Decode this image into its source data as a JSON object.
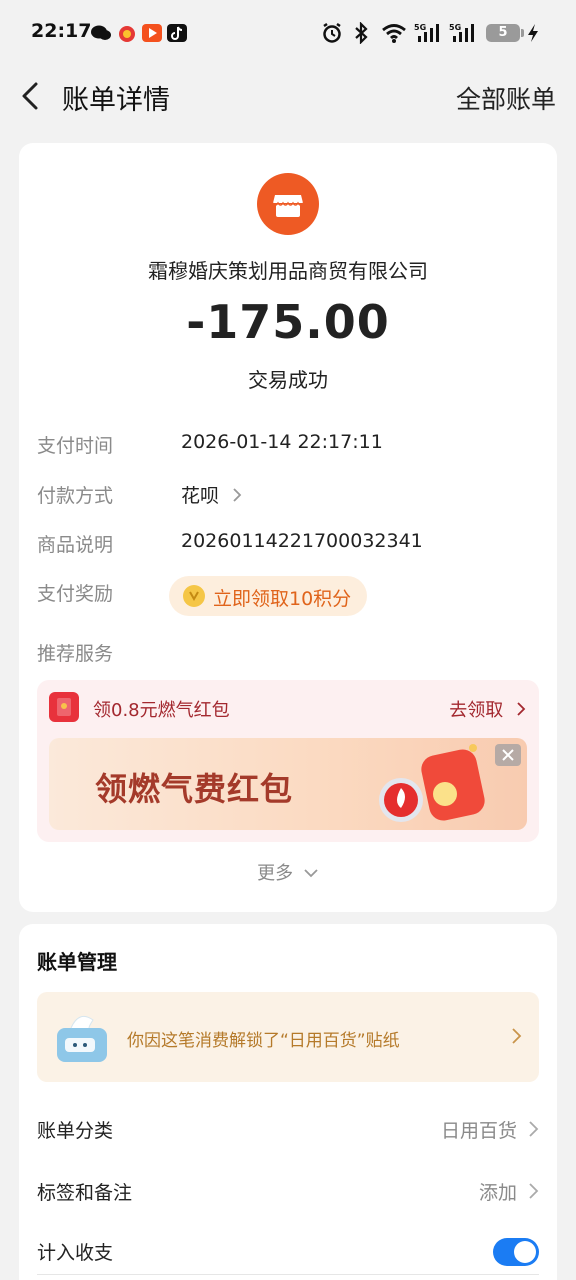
{
  "status_bar": {
    "time": "22:17",
    "battery": "5",
    "icons": [
      "wechat-icon",
      "weibo-icon",
      "video-icon",
      "tiktok-icon",
      "alarm-icon",
      "bluetooth-icon",
      "wifi-icon",
      "signal-5g-icon",
      "signal-5g-icon",
      "charging-icon"
    ]
  },
  "header": {
    "title": "账单详情",
    "right_action": "全部账单"
  },
  "detail": {
    "merchant": "霜穆婚庆策划用品商贸有限公司",
    "amount": "-175.00",
    "status": "交易成功",
    "rows": [
      {
        "label": "支付时间",
        "value": "2026-01-14 22:17:11"
      },
      {
        "label": "付款方式",
        "value": "花呗"
      },
      {
        "label": "商品说明",
        "value": "20260114221700032341"
      },
      {
        "label": "支付奖励",
        "value": "立即领取10积分"
      }
    ],
    "recommend_label": "推荐服务",
    "promo": {
      "title": "领0.8元燃气红包",
      "action": "去领取",
      "banner_text": "领燃气费红包"
    },
    "more": "更多"
  },
  "manage": {
    "title": "账单管理",
    "sticker_text": "你因这笔消费解锁了“日用百货”贴纸",
    "rows": [
      {
        "label": "账单分类",
        "value": "日用百货"
      },
      {
        "label": "标签和备注",
        "value": "添加"
      },
      {
        "label": "计入收支",
        "value": ""
      }
    ],
    "include_in_stats": true
  },
  "colors": {
    "accent_orange": "#ee5a24",
    "toggle_blue": "#1b7cf3",
    "promo_red": "#a3282f"
  }
}
